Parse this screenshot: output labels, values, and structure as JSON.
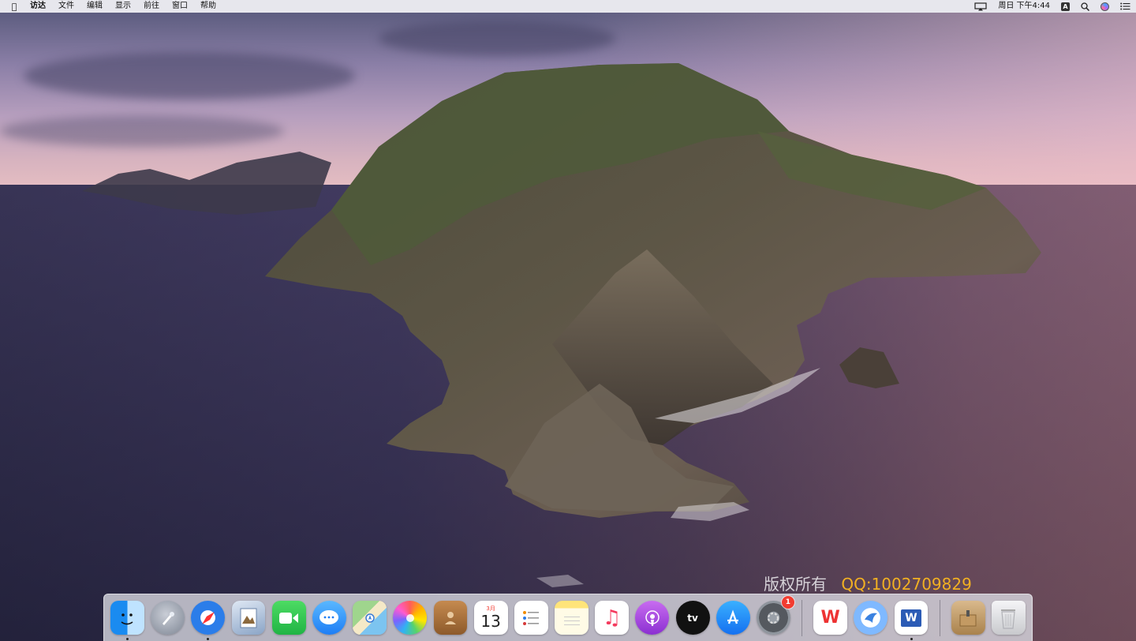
{
  "menubar": {
    "apple_icon": "apple-logo-icon",
    "app_name": "访达",
    "items": [
      "文件",
      "编辑",
      "显示",
      "前往",
      "窗口",
      "帮助"
    ],
    "clock": "周日 下午4:44",
    "input_method": "A",
    "status_icons": [
      "airplay-icon",
      "input-method-icon",
      "spotlight-search-icon",
      "siri-icon",
      "notification-center-icon"
    ]
  },
  "watermark": {
    "text_cn": "版权所有",
    "text_qq": "QQ:1002709829",
    "color_qq": "#f2b022"
  },
  "dock": {
    "calendar_month": "3月",
    "calendar_day": "13",
    "system_preferences_badge": "1",
    "apps": [
      {
        "name": "finder",
        "running": true
      },
      {
        "name": "launchpad",
        "running": false
      },
      {
        "name": "safari",
        "running": true
      },
      {
        "name": "preview",
        "running": false
      },
      {
        "name": "facetime",
        "running": false
      },
      {
        "name": "messages",
        "running": false
      },
      {
        "name": "maps",
        "running": false
      },
      {
        "name": "photos",
        "running": false
      },
      {
        "name": "contacts",
        "running": false
      },
      {
        "name": "calendar",
        "running": false
      },
      {
        "name": "reminders",
        "running": false
      },
      {
        "name": "notes",
        "running": false
      },
      {
        "name": "music",
        "running": false
      },
      {
        "name": "podcasts",
        "running": false
      },
      {
        "name": "apple-tv",
        "running": false
      },
      {
        "name": "app-store",
        "running": false
      },
      {
        "name": "system-preferences",
        "running": false
      },
      {
        "name": "wps-office",
        "running": false
      },
      {
        "name": "bird-app",
        "running": false
      },
      {
        "name": "microsoft-word",
        "running": true
      },
      {
        "name": "archive-utility",
        "running": false
      },
      {
        "name": "trash",
        "running": false
      }
    ],
    "tv_label": "tv",
    "wps_label": "W",
    "word_label": "W"
  },
  "colors": {
    "menubar_bg": "#ececf0",
    "dock_bg": "#dcdce4",
    "badge_red": "#f23b30"
  }
}
